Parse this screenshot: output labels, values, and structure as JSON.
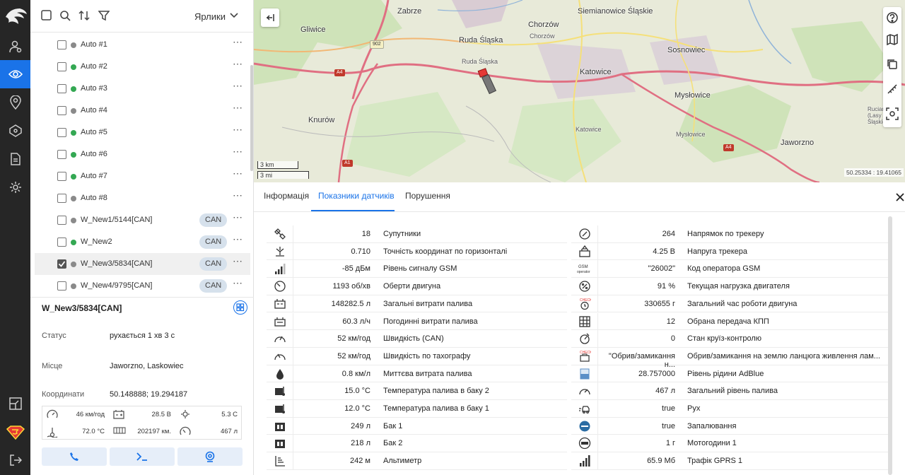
{
  "toolbar": {
    "labels_select": "Ярлики"
  },
  "objects": [
    {
      "name": "Auto #1",
      "status": "offline",
      "can": "",
      "checked": false
    },
    {
      "name": "Auto #2",
      "status": "online",
      "can": "",
      "checked": false
    },
    {
      "name": "Auto #3",
      "status": "online",
      "can": "",
      "checked": false
    },
    {
      "name": "Auto #4",
      "status": "offline",
      "can": "",
      "checked": false
    },
    {
      "name": "Auto #5",
      "status": "online",
      "can": "",
      "checked": false
    },
    {
      "name": "Auto #6",
      "status": "online",
      "can": "",
      "checked": false
    },
    {
      "name": "Auto #7",
      "status": "online",
      "can": "",
      "checked": false
    },
    {
      "name": "Auto #8",
      "status": "offline",
      "can": "",
      "checked": false
    },
    {
      "name": "W_New1/5144[CAN]",
      "status": "offline",
      "can": "CAN",
      "checked": false
    },
    {
      "name": "W_New2",
      "status": "online",
      "can": "CAN",
      "checked": false
    },
    {
      "name": "W_New3/5834[CAN]",
      "status": "offline",
      "can": "CAN",
      "checked": true
    },
    {
      "name": "W_New4/9795[CAN]",
      "status": "offline",
      "can": "CAN",
      "checked": false
    }
  ],
  "colors": {
    "online": "#34a853",
    "offline": "#8a8a8a",
    "accent": "#1a73e8"
  },
  "details": {
    "title": "W_New3/5834[CAN]",
    "status_label": "Статус",
    "status_value": "рухається 1 хв 3 с",
    "place_label": "Місце",
    "place_value": "Jaworzno, Laskowiec",
    "coords_label": "Координати",
    "coords_value": "50.148888; 19.294187",
    "mini": [
      {
        "icon": "speedometer-icon",
        "value": "46 км/год"
      },
      {
        "icon": "battery-icon",
        "value": "28.5 В"
      },
      {
        "icon": "fuel-gear-icon",
        "value": "5.3 C"
      },
      {
        "icon": "temperature-icon",
        "value": "72.0 °C"
      },
      {
        "icon": "odometer-icon",
        "value": "202197 км."
      },
      {
        "icon": "fuel-gauge-icon",
        "value": "467 л"
      }
    ]
  },
  "map": {
    "cities": [
      "Zabrze",
      "Siemianowice Śląskie",
      "Gliwice",
      "Chorzów",
      "Ruda Śląska",
      "Sosnowiec",
      "Katowice",
      "Mysłowice",
      "Knurów",
      "Jaworzno"
    ],
    "small": [
      "Chorzów",
      "Ruda Śląska",
      "Katowice",
      "Mysłowice",
      "Ruciana (Lasy Śląskie)"
    ],
    "roads": [
      "902",
      "A4",
      "A4",
      "A1"
    ],
    "scale_km": "3 km",
    "scale_mi": "3 mi",
    "coords": "50.25334 : 19.41065"
  },
  "tabs": [
    "Інформація",
    "Показники датчиків",
    "Порушення"
  ],
  "sensors_left": [
    {
      "icon": "satellite-icon",
      "value": "18",
      "name": "Супутники"
    },
    {
      "icon": "precision-icon",
      "value": "0.710",
      "name": "Точність координат по горизонталі"
    },
    {
      "icon": "signal-icon",
      "value": "-85 дБм",
      "name": "Рівень сигналу GSM"
    },
    {
      "icon": "rpm-gauge-icon",
      "value": "1193 об/хв",
      "name": "Оберти двигуна"
    },
    {
      "icon": "fuel-total-icon",
      "value": "148282.5 л",
      "name": "Загальні витрати палива"
    },
    {
      "icon": "fuel-hourly-icon",
      "value": "60.3 л/ч",
      "name": "Погодинні витрати палива"
    },
    {
      "icon": "speed-gauge-icon",
      "value": "52 км/год",
      "name": "Швидкість (CAN)"
    },
    {
      "icon": "tacho-gauge-icon",
      "value": "52 км/год",
      "name": "Швидкість по тахографу"
    },
    {
      "icon": "drop-icon",
      "value": "0.8 км/л",
      "name": "Миттєва витрата палива"
    },
    {
      "icon": "fuel-temp-icon",
      "value": "15.0 °C",
      "name": "Температура палива в баку 2"
    },
    {
      "icon": "fuel-temp-icon",
      "value": "12.0 °C",
      "name": "Температура палива в баку 1"
    },
    {
      "icon": "tank-icon",
      "value": "249 л",
      "name": "Бак 1"
    },
    {
      "icon": "tank-icon",
      "value": "218 л",
      "name": "Бак 2"
    },
    {
      "icon": "altitude-icon",
      "value": "242 м",
      "name": "Альтиметр"
    }
  ],
  "sensors_right": [
    {
      "icon": "compass-icon",
      "value": "264",
      "name": "Напрямок по трекеру"
    },
    {
      "icon": "tracker-voltage-icon",
      "value": "4.25 В",
      "name": "Напруга трекера"
    },
    {
      "icon": "gsm-operator-icon",
      "value": "\"26002\"",
      "name": "Код оператора GSM"
    },
    {
      "icon": "percent-icon",
      "value": "91 %",
      "name": "Текущая нагрузка двигателя"
    },
    {
      "icon": "engine-hours-icon",
      "value": "330655 г",
      "name": "Загальний час роботи двигуна"
    },
    {
      "icon": "gear-grid-icon",
      "value": "12",
      "name": "Обрана передача КПП"
    },
    {
      "icon": "cruise-icon",
      "value": "0",
      "name": "Стан круїз-контролю"
    },
    {
      "icon": "check-engine-icon",
      "value": "\"Обрив/замикання н...",
      "name": "Обрив/замикання на землю ланцюга живлення лам..."
    },
    {
      "icon": "adblue-icon",
      "value": "28.757000",
      "name": "Рівень рідини AdBlue"
    },
    {
      "icon": "fuel-level-icon",
      "value": "467 л",
      "name": "Загальний рівень палива"
    },
    {
      "icon": "motion-icon",
      "value": "true",
      "name": "Рух"
    },
    {
      "icon": "ignition-icon",
      "value": "true",
      "name": "Запалювання"
    },
    {
      "icon": "motohours-icon",
      "value": "1 г",
      "name": "Мотогодини 1"
    },
    {
      "icon": "gprs-icon",
      "value": "65.9 Мб",
      "name": "Трафік GPRS 1"
    }
  ]
}
